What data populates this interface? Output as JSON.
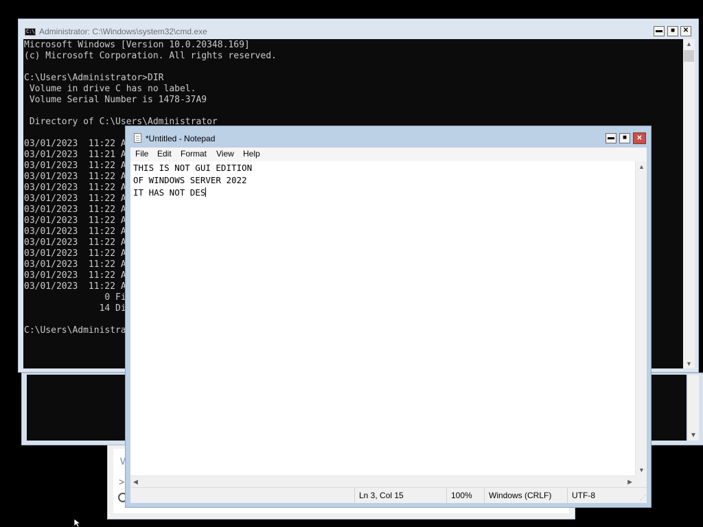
{
  "cmd_window": {
    "title": "Administrator: C:\\Windows\\system32\\cmd.exe",
    "icon_text": "C:\\",
    "console_lines": [
      "Microsoft Windows [Version 10.0.20348.169]",
      "(c) Microsoft Corporation. All rights reserved.",
      "",
      "C:\\Users\\Administrator>DIR",
      " Volume in drive C has no label.",
      " Volume Serial Number is 1478-37A9",
      "",
      " Directory of C:\\Users\\Administrator",
      "",
      "03/01/2023  11:22 A",
      "03/01/2023  11:21 A",
      "03/01/2023  11:22 A",
      "03/01/2023  11:22 A",
      "03/01/2023  11:22 A",
      "03/01/2023  11:22 A",
      "03/01/2023  11:22 A",
      "03/01/2023  11:22 A",
      "03/01/2023  11:22 A",
      "03/01/2023  11:22 A",
      "03/01/2023  11:22 A",
      "03/01/2023  11:22 A",
      "03/01/2023  11:22 A",
      "03/01/2023  11:22 A",
      "               0 Fi",
      "              14 Di",
      "",
      "C:\\Users\\Administra"
    ],
    "buttons": {
      "minimize": "▬",
      "maximize": "■",
      "close": "✕"
    },
    "scroll_up": "▲",
    "scroll_down": "▼"
  },
  "background_window": {
    "scroll_down": "▼",
    "fragments": [
      "W",
      ">"
    ]
  },
  "notepad": {
    "title": "*Untitled - Notepad",
    "buttons": {
      "minimize": "▬",
      "maximize": "■",
      "close": "✕"
    },
    "menu": [
      "File",
      "Edit",
      "Format",
      "View",
      "Help"
    ],
    "text_lines": [
      "THIS IS NOT GUI EDITION",
      "OF WINDOWS SERVER 2022",
      "IT HAS NOT DES"
    ],
    "status": {
      "position": "Ln 3, Col 15",
      "zoom": "100%",
      "line_ending": "Windows (CRLF)",
      "encoding": "UTF-8"
    },
    "scroll_up": "▲",
    "scroll_down": "▼",
    "scroll_left": "◀",
    "scroll_right": "▶",
    "grip": "⋰"
  }
}
